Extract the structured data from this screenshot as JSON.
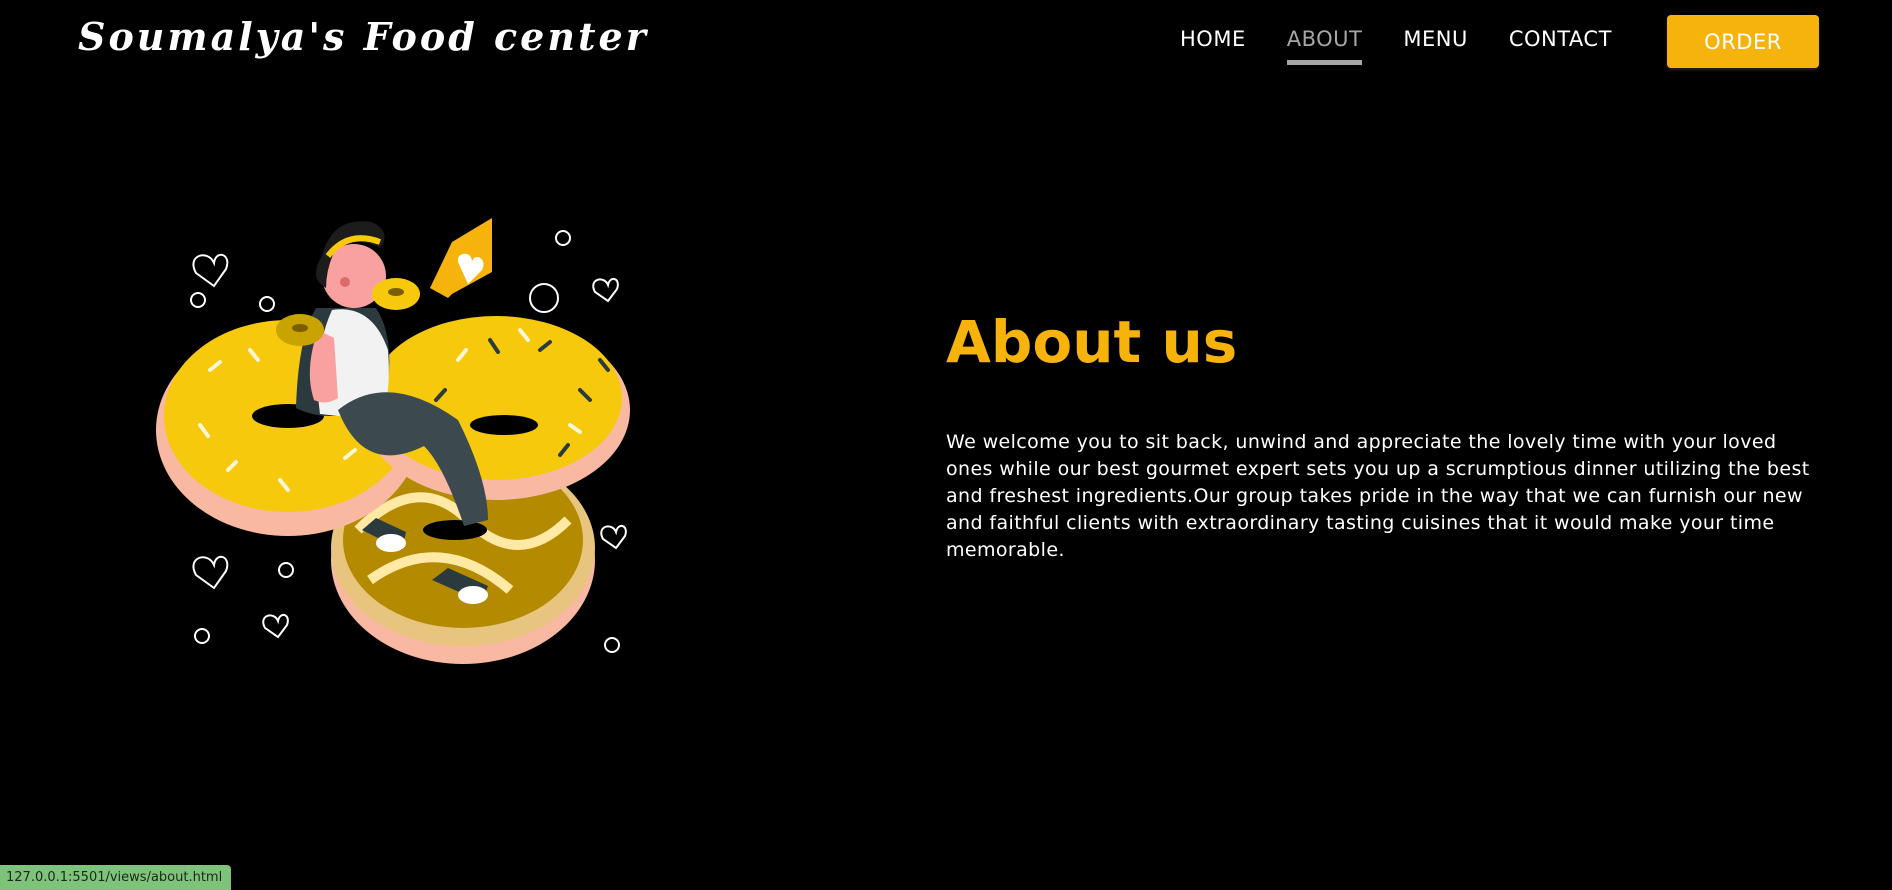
{
  "header": {
    "brand": "Soumalya's Food center",
    "nav": [
      {
        "label": "HOME",
        "active": false
      },
      {
        "label": "ABOUT",
        "active": true
      },
      {
        "label": "MENU",
        "active": false
      },
      {
        "label": "CONTACT",
        "active": false
      }
    ],
    "order_label": "ORDER"
  },
  "about": {
    "title": "About us",
    "body": "We welcome you to sit back, unwind and appreciate the lovely time with your loved ones while our best gourmet expert sets you up a scrumptious dinner utilizing the best and freshest ingredients.Our group takes pride in the way that we can furnish our new and faithful clients with extraordinary tasting cuisines that it would make your time memorable."
  },
  "status_bar": {
    "url": "127.0.0.1:5501/views/about.html"
  },
  "colors": {
    "accent": "#f6b30c",
    "background": "#000000",
    "nav_active": "#a6a6a6",
    "status_bar": "#7ec27b"
  },
  "illustration": {
    "icon": "woman-eating-donuts-illustration"
  }
}
